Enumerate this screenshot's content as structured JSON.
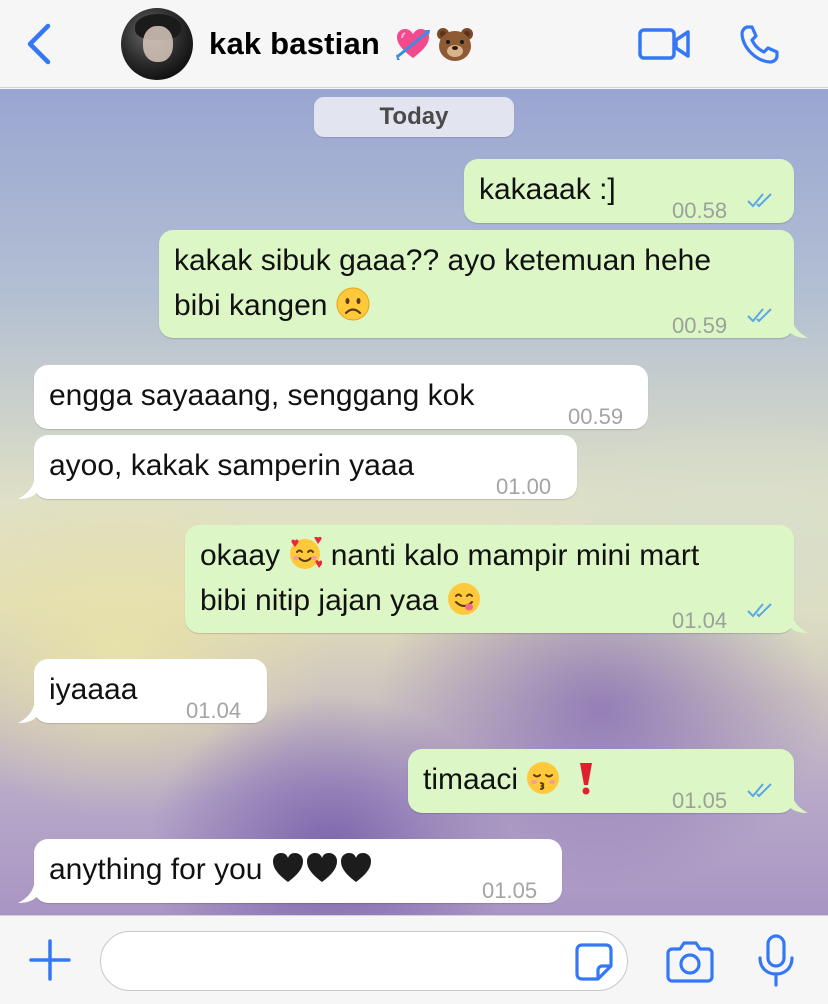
{
  "header": {
    "contact_name": "kak bastian",
    "name_emojis": [
      "heart-with-arrow",
      "bear-face"
    ]
  },
  "chat": {
    "date_label": "Today",
    "messages": [
      {
        "direction": "outgoing",
        "lines": [
          "kakaaak :]"
        ],
        "time": "00.58",
        "read": true
      },
      {
        "direction": "outgoing",
        "lines": [
          "kakak sibuk gaaa?? ayo ketemuan hehe",
          "bibi kangen"
        ],
        "emojis": [
          "frowning-face"
        ],
        "time": "00.59",
        "read": true
      },
      {
        "direction": "incoming",
        "lines": [
          "engga sayaaang, senggang kok"
        ],
        "time": "00.59"
      },
      {
        "direction": "incoming",
        "lines": [
          "ayoo, kakak samperin yaaa"
        ],
        "time": "01.00"
      },
      {
        "direction": "outgoing",
        "lines": [
          "okaay",
          "nanti kalo mampir mini mart",
          "bibi nitip jajan yaa"
        ],
        "emojis": [
          "smiling-face-with-hearts",
          "face-savoring-food"
        ],
        "time": "01.04",
        "read": true
      },
      {
        "direction": "incoming",
        "lines": [
          "iyaaaa"
        ],
        "time": "01.04"
      },
      {
        "direction": "outgoing",
        "lines": [
          "timaaci"
        ],
        "emojis": [
          "kissing-face-closed-eyes",
          "red-exclamation"
        ],
        "time": "01.05",
        "read": true
      },
      {
        "direction": "incoming",
        "lines": [
          "anything for you"
        ],
        "emojis": [
          "black-heart",
          "black-heart",
          "black-heart"
        ],
        "time": "01.05"
      }
    ]
  },
  "composer": {
    "placeholder": "",
    "value": ""
  },
  "colors": {
    "accent": "#3478f6",
    "outgoing_bubble": "#dcf7c5",
    "incoming_bubble": "#ffffff",
    "read_ticks": "#5aa7e8"
  },
  "icons": [
    "chevron-left-icon",
    "video-call-icon",
    "phone-icon",
    "plus-icon",
    "sticker-icon",
    "camera-icon",
    "microphone-icon",
    "double-check-icon"
  ]
}
